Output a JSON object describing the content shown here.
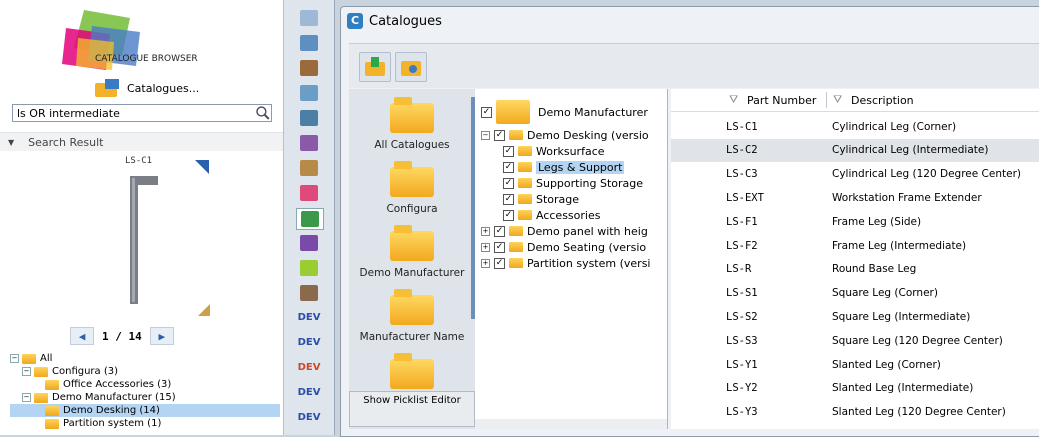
{
  "left": {
    "logo_text": "CATALOGUE BROWSER",
    "catalogues_button": "Catalogues...",
    "search_value": "ls OR intermediate",
    "result_header": "Search Result",
    "preview_label": "LS-C1",
    "pager": "1 / 14",
    "tree": [
      {
        "label": "All",
        "indent": 0,
        "exp": "−"
      },
      {
        "label": "Configura (3)",
        "indent": 1,
        "exp": "−"
      },
      {
        "label": "Office Accessories (3)",
        "indent": 2,
        "exp": ""
      },
      {
        "label": "Demo Manufacturer (15)",
        "indent": 1,
        "exp": "−"
      },
      {
        "label": "Demo Desking (14)",
        "indent": 2,
        "exp": ""
      },
      {
        "label": "Partition system (1)",
        "indent": 2,
        "exp": ""
      }
    ]
  },
  "window": {
    "title": "Catalogues",
    "nav": [
      "All Catalogues",
      "Configura",
      "Demo Manufacturer",
      "Manufacturer Name",
      ""
    ],
    "show_picklist": "Show Picklist Editor",
    "tree": [
      {
        "label": "Demo Manufacturer"
      },
      {
        "label": "Demo Desking (versio"
      },
      {
        "label": "Worksurface"
      },
      {
        "label": "Legs & Support"
      },
      {
        "label": "Supporting Storage"
      },
      {
        "label": "Storage"
      },
      {
        "label": "Accessories"
      },
      {
        "label": "Demo panel with heig"
      },
      {
        "label": "Demo Seating (versio"
      },
      {
        "label": "Partition system (versi"
      }
    ],
    "columns": {
      "part": "Part Number",
      "desc": "Description"
    },
    "parts": [
      {
        "num": "LS-C1",
        "desc": "Cylindrical Leg (Corner)"
      },
      {
        "num": "LS-C2",
        "desc": "Cylindrical Leg (Intermediate)"
      },
      {
        "num": "LS-C3",
        "desc": "Cylindrical Leg (120 Degree Center)"
      },
      {
        "num": "LS-EXT",
        "desc": "Workstation Frame Extender"
      },
      {
        "num": "LS-F1",
        "desc": "Frame Leg (Side)"
      },
      {
        "num": "LS-F2",
        "desc": "Frame Leg (Intermediate)"
      },
      {
        "num": "LS-R",
        "desc": "Round Base Leg"
      },
      {
        "num": "LS-S1",
        "desc": "Square Leg (Corner)"
      },
      {
        "num": "LS-S2",
        "desc": "Square Leg (Intermediate)"
      },
      {
        "num": "LS-S3",
        "desc": "Square Leg (120 Degree Center)"
      },
      {
        "num": "LS-Y1",
        "desc": "Slanted Leg (Corner)"
      },
      {
        "num": "LS-Y2",
        "desc": "Slanted Leg (Intermediate)"
      },
      {
        "num": "LS-Y3",
        "desc": "Slanted Leg (120 Degree Center)"
      }
    ]
  },
  "toolbar_icons": [
    "wall-icon",
    "cube-icon",
    "curtain-icon",
    "pencil-icon",
    "table-icon",
    "cabinet-icon",
    "chair-icon",
    "swirl-icon",
    "catalogue-icon",
    "tower-icon",
    "green-square-icon",
    "lamp-icon",
    "dev-icon",
    "dev-icon",
    "dev-icon",
    "dev-icon",
    "dev-icon"
  ],
  "colors": {
    "accent": "#6d8fb8",
    "selection": "#b3d4f2",
    "folder": "#f2a91e"
  }
}
